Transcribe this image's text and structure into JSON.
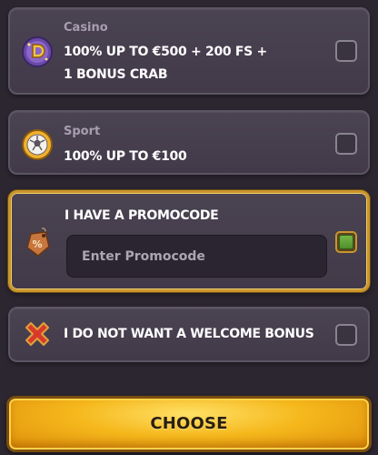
{
  "options": {
    "casino": {
      "category": "Casino",
      "line1": "100% UP TO €500 + 200 FS +",
      "line2": "1 BONUS CRAB",
      "icon": "casino-coin-icon",
      "selected": false
    },
    "sport": {
      "category": "Sport",
      "line1": "100% UP TO €100",
      "icon": "soccer-ball-icon",
      "selected": false
    },
    "promo": {
      "title": "I HAVE A PROMOCODE",
      "placeholder": "Enter Promocode",
      "value": "",
      "icon": "percent-tag-icon",
      "selected": true
    },
    "no_bonus": {
      "title": "I DO NOT WANT A WELCOME BONUS",
      "icon": "red-x-icon",
      "selected": false
    }
  },
  "choose_button": {
    "label": "CHOOSE"
  },
  "colors": {
    "background": "#2b2630",
    "card": "#453e4d",
    "selected_border": "#c9962d",
    "check_green": "#5f9e35",
    "button_gold": "#f5b81c"
  }
}
